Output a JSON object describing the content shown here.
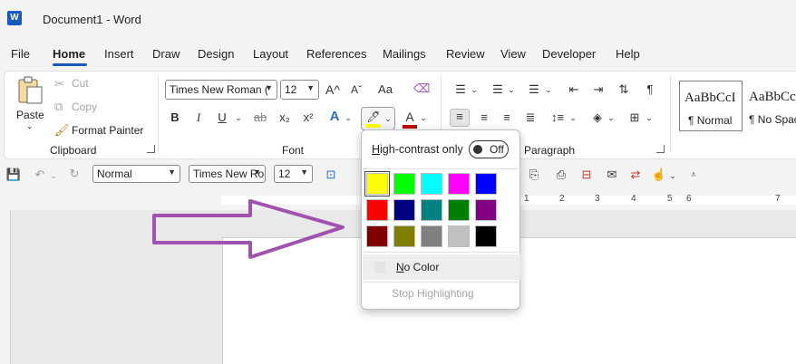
{
  "window": {
    "title": "Document1  -  Word",
    "app_icon": "word-logo-icon"
  },
  "tabs": [
    "File",
    "Home",
    "Insert",
    "Draw",
    "Design",
    "Layout",
    "References",
    "Mailings",
    "Review",
    "View",
    "Developer",
    "Help"
  ],
  "active_tab": "Home",
  "clipboard": {
    "label": "Clipboard",
    "paste": "Paste",
    "cut": "Cut",
    "copy": "Copy",
    "format_painter": "Format Painter"
  },
  "font": {
    "label": "Font",
    "font_name": "Times New Roman (",
    "font_size": "12",
    "bold": "B",
    "italic": "I",
    "underline": "U",
    "strikethrough": "ab",
    "subscript": "x₂",
    "superscript": "x²",
    "grow": "A^",
    "shrink": "Aˇ",
    "change_case": "Aa",
    "text_effects": "A",
    "font_color_glyph": "A"
  },
  "paragraph": {
    "label": "Paragraph"
  },
  "styles": [
    {
      "sample": "AaBbCcI",
      "name": "¶ Normal"
    },
    {
      "sample": "AaBbCc",
      "name": "¶ No Spac"
    }
  ],
  "qat": {
    "style": "Normal",
    "font_name": "Times New Ro",
    "font_size": "12"
  },
  "ruler": {
    "numbers": [
      "1",
      "2",
      "3",
      "4",
      "5",
      "6",
      "7"
    ]
  },
  "highlight_menu": {
    "high_contrast_label": "High-contrast only",
    "toggle_state": "Off",
    "colors": [
      [
        "#ffff00",
        "#00ff00",
        "#00ffff",
        "#ff00ff",
        "#0000ff"
      ],
      [
        "#ff0000",
        "#000080",
        "#008080",
        "#008000",
        "#800080"
      ],
      [
        "#800000",
        "#808000",
        "#808080",
        "#c0c0c0",
        "#000000"
      ]
    ],
    "no_color": "No Color",
    "stop_highlighting": "Stop Highlighting"
  },
  "colors": {
    "accent": "#185abd",
    "arrow": "#a052b0",
    "highlight_bar": "#ffff00",
    "font_color_bar": "#c00000"
  }
}
